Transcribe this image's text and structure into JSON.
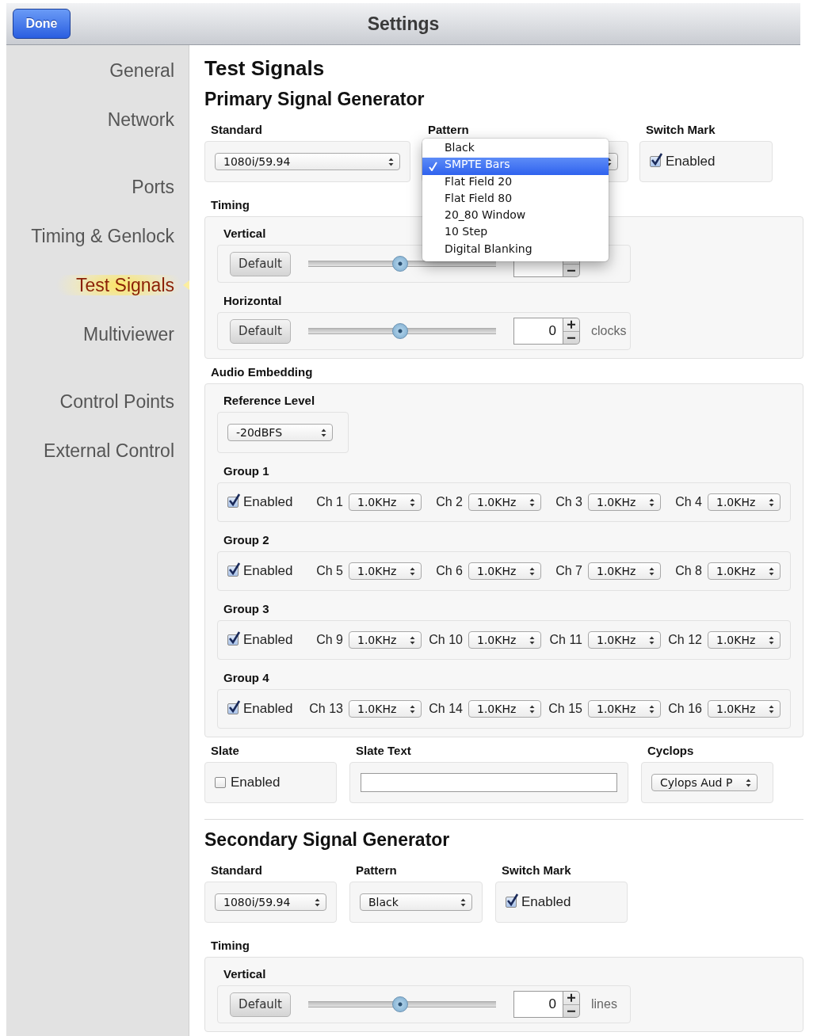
{
  "header": {
    "done": "Done",
    "title": "Settings"
  },
  "sidebar": {
    "groups": [
      {
        "items": [
          {
            "label": "General",
            "selected": false
          },
          {
            "label": "Network",
            "selected": false
          }
        ]
      },
      {
        "items": [
          {
            "label": "Ports",
            "selected": false
          },
          {
            "label": "Timing & Genlock",
            "selected": false
          },
          {
            "label": "Test Signals",
            "selected": true
          },
          {
            "label": "Multiviewer",
            "selected": false
          }
        ]
      },
      {
        "items": [
          {
            "label": "Control Points",
            "selected": false
          },
          {
            "label": "External Control",
            "selected": false
          }
        ]
      }
    ]
  },
  "page_title": "Test Signals",
  "generators": [
    {
      "title": "Primary Signal Generator",
      "standard": {
        "label": "Standard",
        "value": "1080i/59.94"
      },
      "pattern": {
        "label": "Pattern",
        "menu": [
          {
            "label": "Black",
            "selected": false
          },
          {
            "label": "SMPTE Bars",
            "selected": true
          },
          {
            "label": "Flat Field 20",
            "selected": false
          },
          {
            "label": "Flat Field 80",
            "selected": false
          },
          {
            "label": "20_80 Window",
            "selected": false
          },
          {
            "label": "10 Step",
            "selected": false
          },
          {
            "label": "Digital Blanking",
            "selected": false
          }
        ]
      },
      "switch_mark": {
        "label": "Switch Mark",
        "option": "Enabled",
        "checked": true
      },
      "timing": {
        "label": "Timing",
        "rows": [
          {
            "label": "Vertical",
            "button": "Default",
            "level": 0.49
          },
          {
            "label": "Horizontal",
            "button": "Default",
            "level": 0.49,
            "value": "0",
            "unit": "clocks"
          }
        ]
      },
      "audio": {
        "label": "Audio Embedding",
        "reference": {
          "label": "Reference Level",
          "value": "-20dBFS"
        },
        "groups": [
          {
            "label": "Group 1",
            "option": "Enabled",
            "checked": true,
            "channels": [
              {
                "label": "Ch 1",
                "value": "1.0KHz"
              },
              {
                "label": "Ch 2",
                "value": "1.0KHz"
              },
              {
                "label": "Ch 3",
                "value": "1.0KHz"
              },
              {
                "label": "Ch 4",
                "value": "1.0KHz"
              }
            ]
          },
          {
            "label": "Group 2",
            "option": "Enabled",
            "checked": true,
            "channels": [
              {
                "label": "Ch 5",
                "value": "1.0KHz"
              },
              {
                "label": "Ch 6",
                "value": "1.0KHz"
              },
              {
                "label": "Ch 7",
                "value": "1.0KHz"
              },
              {
                "label": "Ch 8",
                "value": "1.0KHz"
              }
            ]
          },
          {
            "label": "Group 3",
            "option": "Enabled",
            "checked": true,
            "channels": [
              {
                "label": "Ch 9",
                "value": "1.0KHz"
              },
              {
                "label": "Ch 10",
                "value": "1.0KHz"
              },
              {
                "label": "Ch 11",
                "value": "1.0KHz"
              },
              {
                "label": "Ch 12",
                "value": "1.0KHz"
              }
            ]
          },
          {
            "label": "Group 4",
            "option": "Enabled",
            "checked": true,
            "channels": [
              {
                "label": "Ch 13",
                "value": "1.0KHz"
              },
              {
                "label": "Ch 14",
                "value": "1.0KHz"
              },
              {
                "label": "Ch 15",
                "value": "1.0KHz"
              },
              {
                "label": "Ch 16",
                "value": "1.0KHz"
              }
            ]
          }
        ]
      },
      "slate": {
        "label": "Slate",
        "option": "Enabled",
        "checked": false
      },
      "slate_text": {
        "label": "Slate Text"
      },
      "cyclops": {
        "label": "Cyclops",
        "value": "Cylops Aud P"
      }
    },
    {
      "title": "Secondary Signal Generator",
      "standard": {
        "label": "Standard",
        "value": "1080i/59.94"
      },
      "pattern": {
        "label": "Pattern",
        "value": "Black"
      },
      "switch_mark": {
        "label": "Switch Mark",
        "option": "Enabled",
        "checked": true
      },
      "timing": {
        "label": "Timing",
        "rows": [
          {
            "label": "Vertical",
            "button": "Default",
            "level": 0.49,
            "value": "0",
            "unit": "lines"
          }
        ]
      }
    }
  ]
}
